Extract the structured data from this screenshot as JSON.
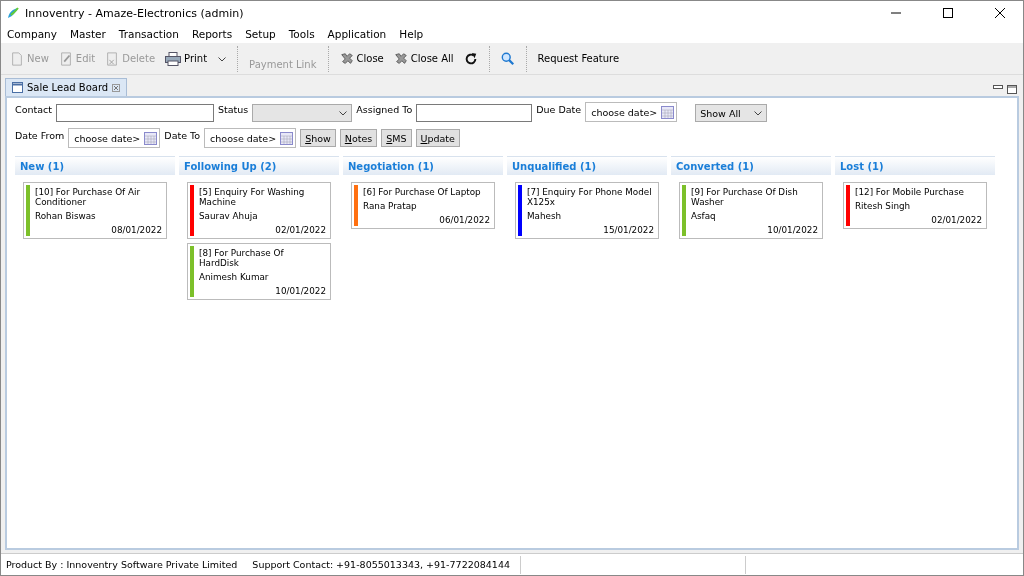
{
  "window": {
    "title": "Innoventry - Amaze-Electronics (admin)"
  },
  "menu": [
    "Company",
    "Master",
    "Transaction",
    "Reports",
    "Setup",
    "Tools",
    "Application",
    "Help"
  ],
  "toolbar": [
    {
      "kind": "new",
      "label": "New",
      "disabled": true
    },
    {
      "kind": "edit",
      "label": "Edit",
      "disabled": true
    },
    {
      "kind": "delete",
      "label": "Delete",
      "disabled": true
    },
    {
      "kind": "print",
      "label": "Print",
      "disabled": false
    },
    {
      "kind": "sep"
    },
    {
      "kind": "payment",
      "label": "Payment Link",
      "disabled": true
    },
    {
      "kind": "sep"
    },
    {
      "kind": "close",
      "label": "Close",
      "disabled": false
    },
    {
      "kind": "close",
      "label": "Close All",
      "disabled": false
    },
    {
      "kind": "refresh",
      "disabled": false
    },
    {
      "kind": "sep"
    },
    {
      "kind": "search",
      "disabled": false
    },
    {
      "kind": "sep"
    },
    {
      "kind": "text",
      "label": "Request Feature",
      "disabled": false
    }
  ],
  "tab": {
    "label": "Sale Lead Board",
    "selected": true
  },
  "filters": {
    "contact_label": "Contact",
    "status_label": "Status",
    "assigned_label": "Assigned To",
    "due_label": "Due Date",
    "due_placeholder": "choose date>",
    "show_select": "Show All",
    "from_label": "Date From",
    "from_placeholder": "choose date>",
    "to_label": "Date To",
    "to_placeholder": "choose date>",
    "buttons": [
      "Show",
      "Notes",
      "SMS",
      "Update"
    ]
  },
  "columns": [
    {
      "title": "New (1)",
      "cards": [
        {
          "title": "[10] For Purchase Of Air Conditioner",
          "person": "Rohan Biswas",
          "date": "08/01/2022",
          "color": "#7cc02a"
        }
      ]
    },
    {
      "title": "Following Up (2)",
      "cards": [
        {
          "title": "[5] Enquiry For Washing Machine",
          "person": "Saurav Ahuja",
          "date": "02/01/2022",
          "color": "#ff0000"
        },
        {
          "title": "[8] For Purchase Of HardDisk",
          "person": "Animesh Kumar",
          "date": "10/01/2022",
          "color": "#7cc02a"
        }
      ]
    },
    {
      "title": "Negotiation (1)",
      "cards": [
        {
          "title": "[6] For Purchase Of Laptop",
          "person": "Rana Pratap",
          "date": "06/01/2022",
          "color": "#ff7010"
        }
      ]
    },
    {
      "title": "Unqualified (1)",
      "cards": [
        {
          "title": "[7] Enquiry For Phone Model X125x",
          "person": "Mahesh",
          "date": "15/01/2022",
          "color": "#0000ff"
        }
      ]
    },
    {
      "title": "Converted (1)",
      "cards": [
        {
          "title": "[9] For Purchase Of Dish Washer",
          "person": "Asfaq",
          "date": "10/01/2022",
          "color": "#7cc02a"
        }
      ]
    },
    {
      "title": "Lost (1)",
      "cards": [
        {
          "title": "[12] For Mobile Purchase",
          "person": "Ritesh Singh",
          "date": "02/01/2022",
          "color": "#ff0000"
        }
      ]
    }
  ],
  "status_bar": [
    "Product By : Innoventry Software Private Limited",
    "Support Contact: +91-8055013343, +91-7722084144"
  ]
}
